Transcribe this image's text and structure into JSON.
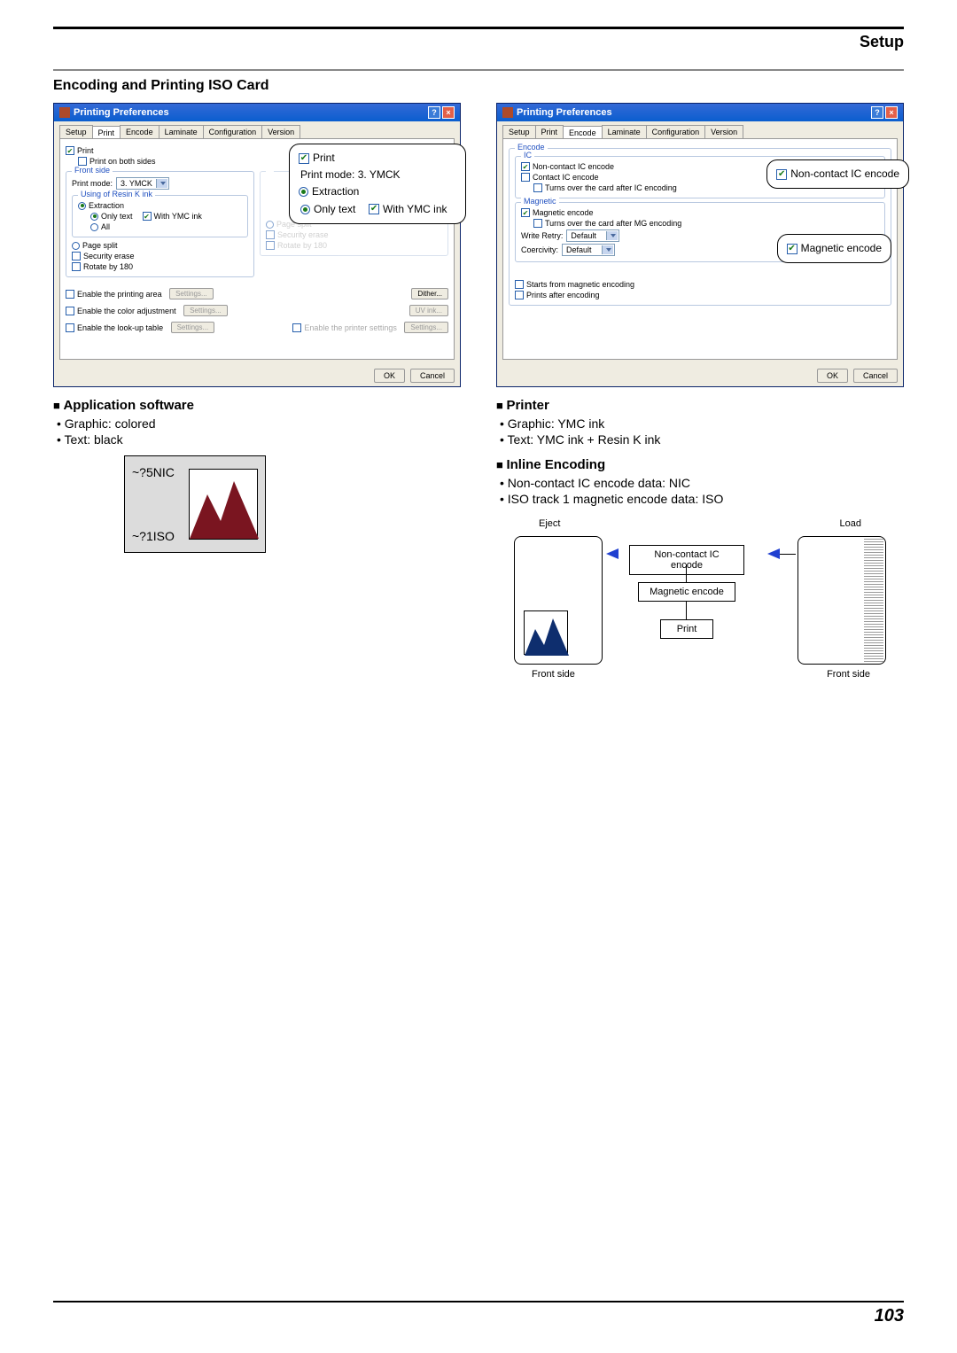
{
  "header": {
    "title": "Setup"
  },
  "section_title": "Encoding and Printing ISO Card",
  "dialog_title": "Printing Preferences",
  "tabs": [
    "Setup",
    "Print",
    "Encode",
    "Laminate",
    "Configuration",
    "Version"
  ],
  "print_tab": {
    "print": "Print",
    "print_both": "Print on both sides",
    "front_side": "Front side",
    "print_mode_label": "Print mode:",
    "print_mode_value": "3. YMCK",
    "using_k": "Using of Resin K ink",
    "extraction": "Extraction",
    "only_text": "Only text",
    "with_ymc": "With YMC ink",
    "all": "All",
    "page_split": "Page split",
    "security_erase": "Security erase",
    "rotate": "Rotate by 180",
    "enable_print_area": "Enable the printing area",
    "enable_color": "Enable the color adjustment",
    "enable_lut": "Enable the look-up table",
    "enable_printer_settings": "Enable the printer settings",
    "settings": "Settings...",
    "dither": "Dither...",
    "uvink": "UV ink..."
  },
  "encode_tab": {
    "encode": "Encode",
    "ic": "IC",
    "noncontact_ic": "Non-contact IC encode",
    "contact_ic": "Contact IC encode",
    "turns_ic": "Turns over the card after IC encoding",
    "magnetic": "Magnetic",
    "magnetic_encode": "Magnetic encode",
    "turns_mg": "Turns over the card after MG encoding",
    "write_retry": "Write Retry:",
    "coercivity": "Coercivity:",
    "default": "Default",
    "starts_mag": "Starts from magnetic encoding",
    "prints_after": "Prints after encoding"
  },
  "buttons": {
    "ok": "OK",
    "cancel": "Cancel"
  },
  "callout_print": {
    "print": "Print",
    "print_mode": "Print mode:  3. YMCK",
    "extraction": "Extraction",
    "only_text": "Only text",
    "with_ymc": "With YMC ink"
  },
  "callout_encode": {
    "nc": "Non-contact IC encode",
    "mag": "Magnetic encode"
  },
  "app_sw": {
    "head": "Application software",
    "b1": "Graphic: colored",
    "b2": "Text: black"
  },
  "printer": {
    "head": "Printer",
    "b1": "Graphic: YMC ink",
    "b2": "Text: YMC ink + Resin K ink"
  },
  "inline": {
    "head": "Inline Encoding",
    "b1": "Non-contact IC encode data: NIC",
    "b2": "ISO track 1 magnetic encode data: ISO"
  },
  "card_sample": {
    "nic": "~?5NIC",
    "iso": "~?1ISO"
  },
  "flow": {
    "eject": "Eject",
    "load": "Load",
    "nc": "Non-contact IC encode",
    "mag": "Magnetic encode",
    "print": "Print",
    "front": "Front side"
  },
  "page_num": "103"
}
